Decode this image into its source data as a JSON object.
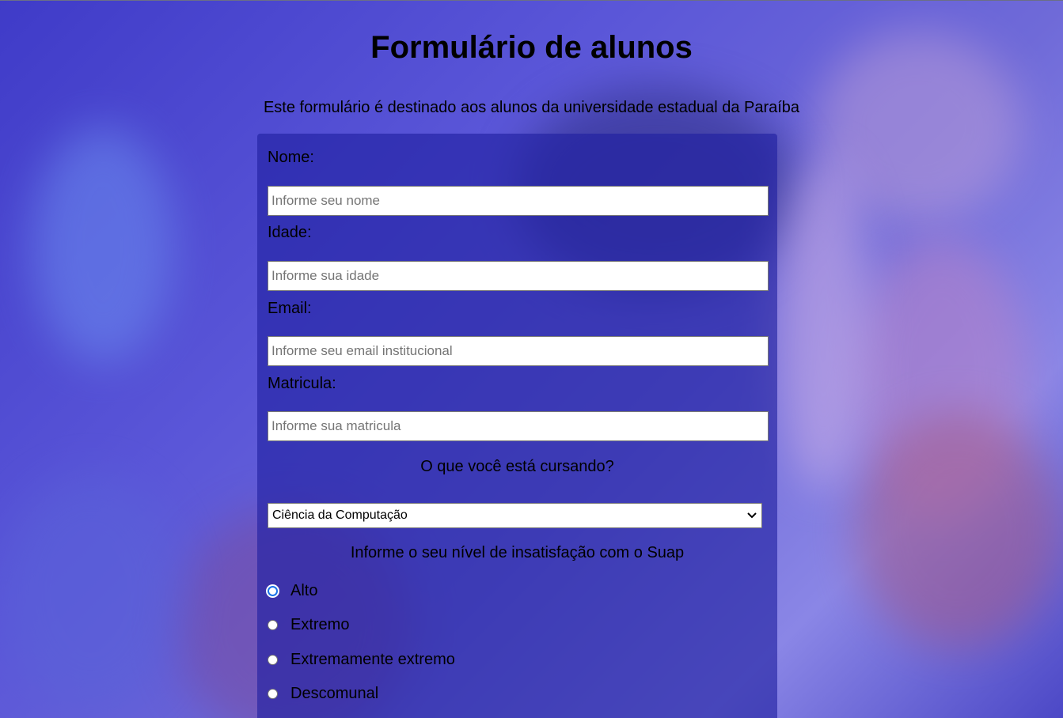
{
  "page": {
    "title": "Formulário de alunos",
    "subtitle": "Este formulário é destinado aos alunos da universidade estadual da Paraíba"
  },
  "form": {
    "name_label": "Nome:",
    "name_placeholder": "Informe seu nome",
    "age_label": "Idade:",
    "age_placeholder": "Informe sua idade",
    "email_label": "Email:",
    "email_placeholder": "Informe seu email institucional",
    "registration_label": "Matricula:",
    "registration_placeholder": "Informe sua matricula",
    "course_question": "O que você está cursando?",
    "course_selected": "Ciência da Computação",
    "dissatisfaction_question": "Informe o seu nível de insatisfação com o Suap",
    "dissatisfaction_options": [
      {
        "label": "Alto",
        "checked": true
      },
      {
        "label": "Extremo",
        "checked": false
      },
      {
        "label": "Extremamente extremo",
        "checked": false
      },
      {
        "label": "Descomunal",
        "checked": false
      }
    ]
  },
  "icons": {
    "select_arrow": "chevron-down-icon"
  },
  "colors": {
    "accent": "#1a73e8",
    "card": "#1e1ea0"
  }
}
